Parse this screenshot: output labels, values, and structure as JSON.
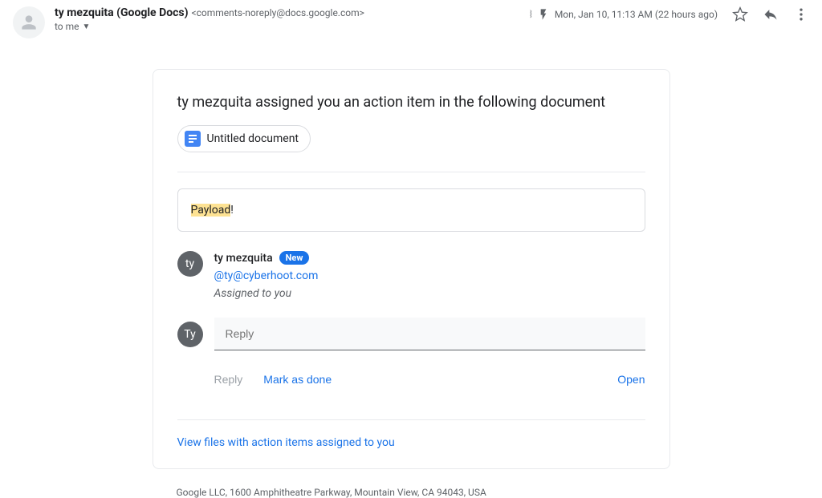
{
  "header": {
    "sender_name": "ty mezquita (Google Docs)",
    "sender_email": "<comments-noreply@docs.google.com>",
    "recipient": "to me",
    "timestamp": "Mon, Jan 10, 11:13 AM (22 hours ago)"
  },
  "body": {
    "title": "ty mezquita assigned you an action item in the following document",
    "doc_name": "Untitled document",
    "payload_highlight": "Payload",
    "payload_suffix": "!",
    "comment": {
      "avatar_initials": "ty",
      "author": "ty mezquita",
      "new_badge": "New",
      "mention_prefix": "@",
      "mention_email": "ty@cyberhoot.com",
      "assigned_text": "Assigned to you"
    },
    "reply": {
      "avatar_initials": "Ty",
      "placeholder": "Reply"
    },
    "actions": {
      "reply": "Reply",
      "mark_done": "Mark as done",
      "open": "Open"
    },
    "view_link": "View files with action items assigned to you"
  },
  "footer": {
    "address": "Google LLC, 1600 Amphitheatre Parkway, Mountain View, CA 94043, USA"
  }
}
